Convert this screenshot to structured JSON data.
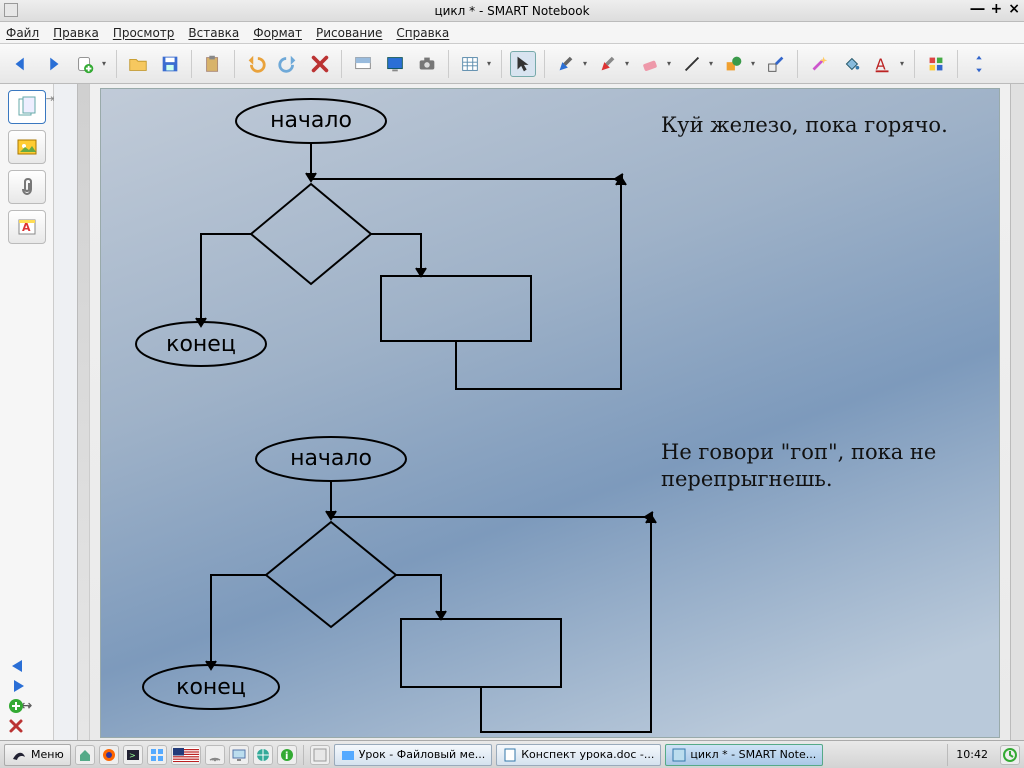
{
  "window": {
    "title": "цикл * - SMART Notebook"
  },
  "menu": {
    "file": "Файл",
    "edit": "Правка",
    "view": "Просмотр",
    "insert": "Вставка",
    "format": "Формат",
    "draw": "Рисование",
    "help": "Справка"
  },
  "flowchart": {
    "top": {
      "start": "начало",
      "end": "конец",
      "proverb": "Куй железо, пока горячо."
    },
    "bottom": {
      "start": "начало",
      "end": "конец",
      "proverb": "Не говори \"гоп\", пока не перепрыгнешь."
    }
  },
  "taskbar": {
    "start": "Меню",
    "items": [
      {
        "label": "Урок - Файловый ме..."
      },
      {
        "label": "Конспект урока.doc -..."
      },
      {
        "label": "цикл * - SMART Note..."
      }
    ],
    "clock": "10:42"
  }
}
